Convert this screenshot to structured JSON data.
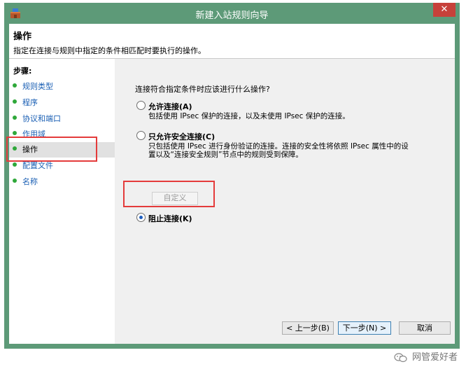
{
  "window": {
    "title": "新建入站规则向导",
    "close_glyph": "✕",
    "frame_color": "#5d9a78"
  },
  "header": {
    "title": "操作",
    "description": "指定在连接与规则中指定的条件相匹配时要执行的操作。"
  },
  "steps": {
    "title": "步骤:",
    "items": [
      {
        "label": "规则类型",
        "active": false
      },
      {
        "label": "程序",
        "active": false
      },
      {
        "label": "协议和端口",
        "active": false
      },
      {
        "label": "作用域",
        "active": false
      },
      {
        "label": "操作",
        "active": true
      },
      {
        "label": "配置文件",
        "active": false
      },
      {
        "label": "名称",
        "active": false
      }
    ]
  },
  "main": {
    "prompt": "连接符合指定条件时应该进行什么操作?",
    "options": [
      {
        "label": "允许连接(A)",
        "description": [
          "包括使用 IPsec 保护的连接，以及未使用 IPsec 保护的连接。"
        ],
        "checked": false
      },
      {
        "label": "只允许安全连接(C)",
        "description": [
          "只包括使用 IPsec 进行身份验证的连接。连接的安全性将依照 IPsec 属性中的设",
          "置以及“连接安全规则”节点中的规则受到保障。"
        ],
        "checked": false
      },
      {
        "label": "阻止连接(K)",
        "description": [],
        "checked": true
      }
    ],
    "customize_label": "自定义"
  },
  "buttons": {
    "back": "< 上一步(B)",
    "next": "下一步(N) >",
    "cancel": "取消"
  },
  "watermark": "网管爱好者",
  "icons": {
    "app": "firewall-shield-icon",
    "close": "close-icon",
    "step_bullet": "green-dot-icon",
    "watermark": "wechat-icon"
  },
  "colors": {
    "accent": "#1f5fbf",
    "step_link": "#1a5fb4",
    "highlight_box": "#e43b3b",
    "close_button": "#c7413a"
  }
}
